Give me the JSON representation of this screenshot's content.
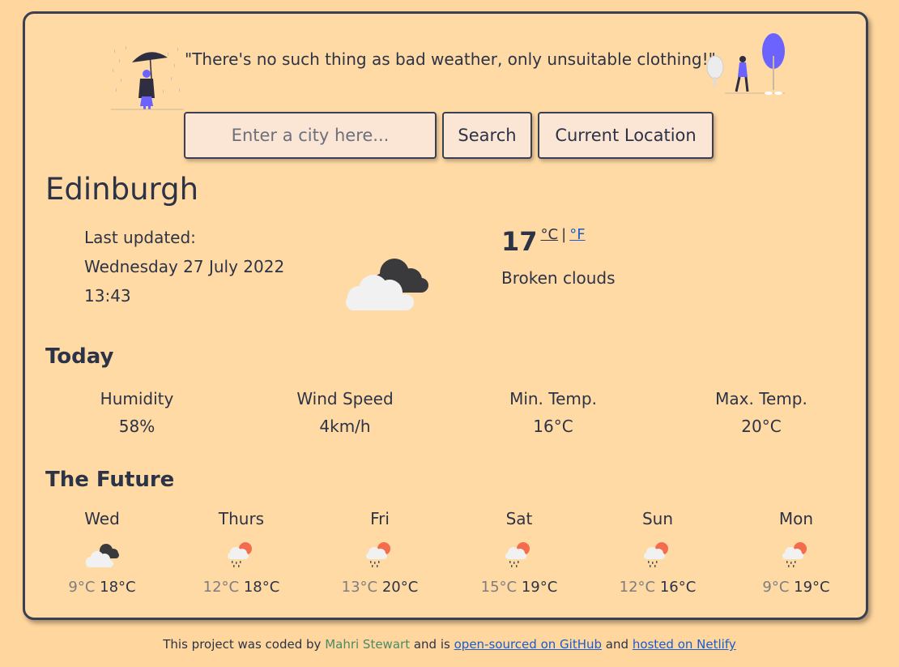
{
  "quote": "\"There's no such thing as bad weather, only unsuitable clothing!\"",
  "search": {
    "placeholder": "Enter a city here...",
    "button_label": "Search",
    "current_location_label": "Current Location"
  },
  "current": {
    "city": "Edinburgh",
    "last_updated_label": "Last updated:",
    "date": "Wednesday 27 July 2022",
    "time": "13:43",
    "temperature": "17",
    "unit_c": "°C",
    "unit_sep": "|",
    "unit_f": "°F",
    "description": "Broken clouds",
    "icon": "broken-clouds-icon"
  },
  "today": {
    "title": "Today",
    "stats": [
      {
        "label": "Humidity",
        "value": "58%"
      },
      {
        "label": "Wind Speed",
        "value": "4km/h"
      },
      {
        "label": "Min. Temp.",
        "value": "16°C"
      },
      {
        "label": "Max. Temp.",
        "value": "20°C"
      }
    ]
  },
  "future": {
    "title": "The Future",
    "days": [
      {
        "day": "Wed",
        "icon": "broken-clouds-icon",
        "min": "9°C",
        "max": "18°C"
      },
      {
        "day": "Thurs",
        "icon": "rain-sun-icon",
        "min": "12°C",
        "max": "18°C"
      },
      {
        "day": "Fri",
        "icon": "rain-sun-icon",
        "min": "13°C",
        "max": "20°C"
      },
      {
        "day": "Sat",
        "icon": "rain-sun-icon",
        "min": "15°C",
        "max": "19°C"
      },
      {
        "day": "Sun",
        "icon": "rain-sun-icon",
        "min": "12°C",
        "max": "16°C"
      },
      {
        "day": "Mon",
        "icon": "rain-sun-icon",
        "min": "9°C",
        "max": "19°C"
      }
    ]
  },
  "footer": {
    "prefix": "This project was coded by",
    "author": "Mahri Stewart",
    "middle": "and is",
    "github_link": "open-sourced on GitHub",
    "and": "and",
    "netlify_link": "hosted on Netlify"
  },
  "colors": {
    "background": "#ffd69e",
    "card": "#ffdaa4",
    "text": "#2c3346",
    "link": "#1a5ccc",
    "author": "#4c8a63",
    "accent_purple": "#6c63ff"
  }
}
